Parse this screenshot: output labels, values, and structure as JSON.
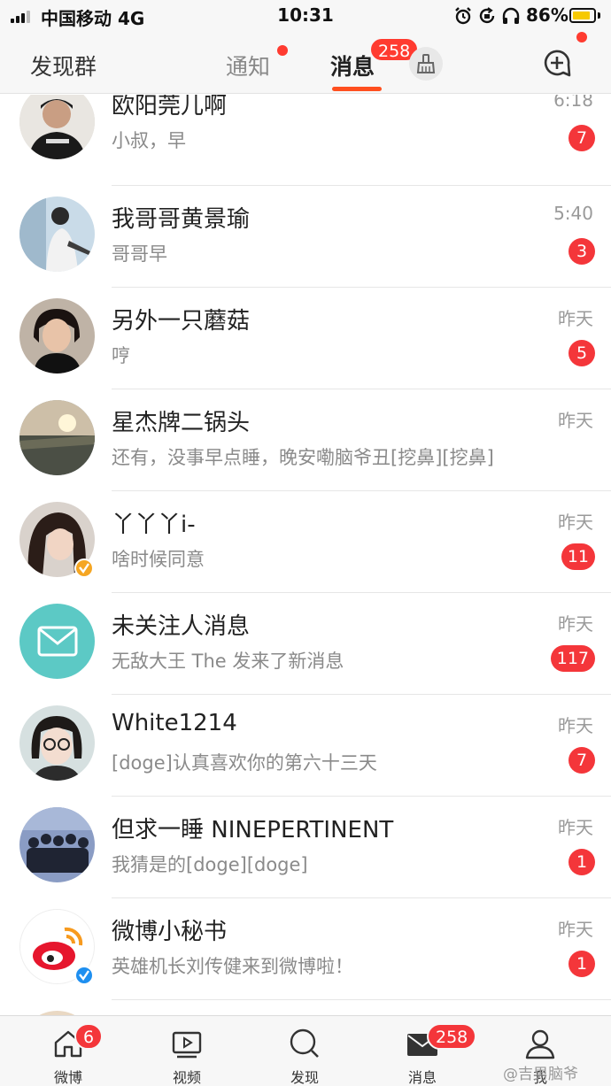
{
  "status_bar": {
    "carrier": "中国移动 4G",
    "time": "10:31",
    "battery_percent": "86%",
    "battery_level": 0.86,
    "icons": [
      "alarm-icon",
      "orientation-lock-icon",
      "headphones-icon"
    ]
  },
  "header": {
    "left_label": "发现群",
    "tab_notify": "通知",
    "tab_messages": "消息",
    "messages_badge": "258",
    "accent_color": "#ff4f1f",
    "icons": [
      "broom-icon",
      "compose-plus-icon"
    ]
  },
  "messages": [
    {
      "name": "欧阳莞儿啊",
      "preview": "小叔，早",
      "time": "6:18",
      "badge": "7"
    },
    {
      "name": "我哥哥黄景瑜",
      "preview": "哥哥早",
      "time": "5:40",
      "badge": "3"
    },
    {
      "name": "另外一只蘑菇",
      "preview": "哼",
      "time": "昨天",
      "badge": "5"
    },
    {
      "name": "星杰牌二锅头",
      "preview": "还有，没事早点睡，晚安嘞脑爷丑[挖鼻][挖鼻]",
      "time": "昨天",
      "badge": ""
    },
    {
      "name": "丫丫丫i-",
      "preview": "啥时候同意",
      "time": "昨天",
      "badge": "11"
    },
    {
      "name": "未关注人消息",
      "preview": "无敌大王 The 发来了新消息",
      "time": "昨天",
      "badge": "117"
    },
    {
      "name": "White1214",
      "preview": "[doge]认真喜欢你的第六十三天",
      "time": "昨天",
      "badge": "7"
    },
    {
      "name": "但求一睡 NINEPERTINENT",
      "preview": "我猜是的[doge][doge]",
      "time": "昨天",
      "badge": "1"
    },
    {
      "name": "微博小秘书",
      "preview": "英雄机长刘传健来到微博啦！",
      "time": "昨天",
      "badge": "1"
    }
  ],
  "tabbar": {
    "items": [
      {
        "label": "微博",
        "badge": "6",
        "icon": "home-icon"
      },
      {
        "label": "视频",
        "badge": "",
        "icon": "video-icon"
      },
      {
        "label": "发现",
        "badge": "",
        "icon": "search-icon"
      },
      {
        "label": "消息",
        "badge": "258",
        "icon": "mail-icon"
      },
      {
        "label": "我",
        "badge": "",
        "icon": "profile-icon"
      }
    ],
    "watermark": "@吉男脑爷"
  },
  "colors": {
    "badge_red": "#f4363a",
    "mail_avatar_teal": "#5cc9c5",
    "verified_yellow": "#f5a623",
    "verified_blue": "#1e8ff0"
  }
}
